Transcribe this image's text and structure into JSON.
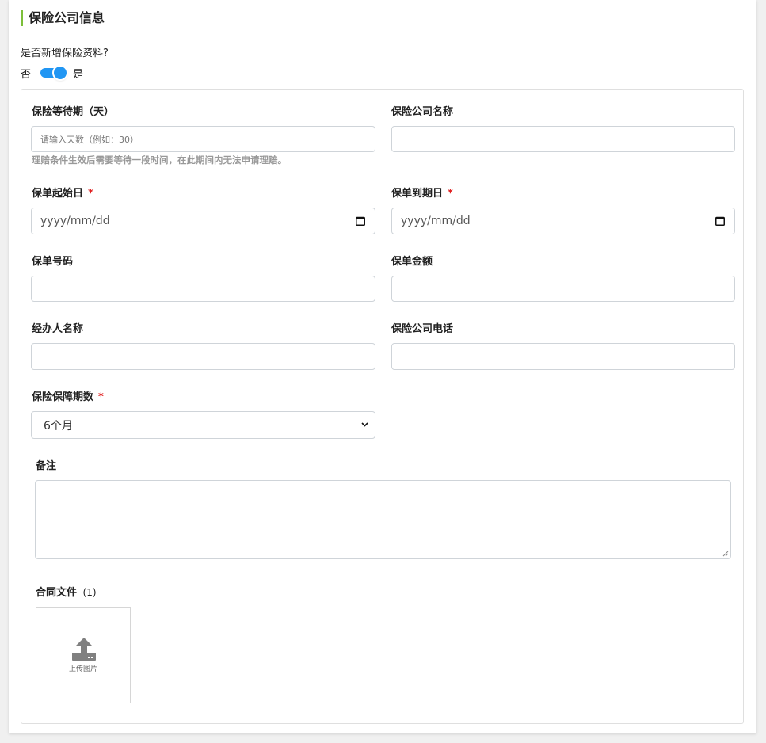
{
  "section": {
    "title": "保险公司信息"
  },
  "toggle": {
    "question": "是否新增保险资料?",
    "off_label": "否",
    "on_label": "是",
    "state": "on"
  },
  "fields": {
    "waiting_period": {
      "label": "保险等待期（天）",
      "placeholder": "请输入天数（例如：30）",
      "hint": "理赔条件生效后需要等待一段时间，在此期间内无法申请理赔。"
    },
    "company_name": {
      "label": "保险公司名称",
      "value": ""
    },
    "start_date": {
      "label": "保单起始日",
      "required_mark": "*",
      "placeholder": "yyyy/mm/dd"
    },
    "end_date": {
      "label": "保单到期日",
      "required_mark": "*",
      "placeholder": "yyyy/mm/dd"
    },
    "policy_number": {
      "label": "保单号码",
      "value": ""
    },
    "policy_amount": {
      "label": "保单金额",
      "value": ""
    },
    "agent_name": {
      "label": "经办人名称",
      "value": ""
    },
    "company_phone": {
      "label": "保险公司电话",
      "value": ""
    },
    "coverage_period": {
      "label": "保险保障期数",
      "required_mark": "*",
      "selected": "6个月"
    },
    "remarks": {
      "label": "备注",
      "value": ""
    },
    "contract": {
      "label": "合同文件",
      "count": "(1)",
      "upload_label": "上传图片"
    }
  },
  "colors": {
    "accent_bar": "#7cbf3a",
    "toggle": "#2196f3",
    "required": "#e02020"
  }
}
